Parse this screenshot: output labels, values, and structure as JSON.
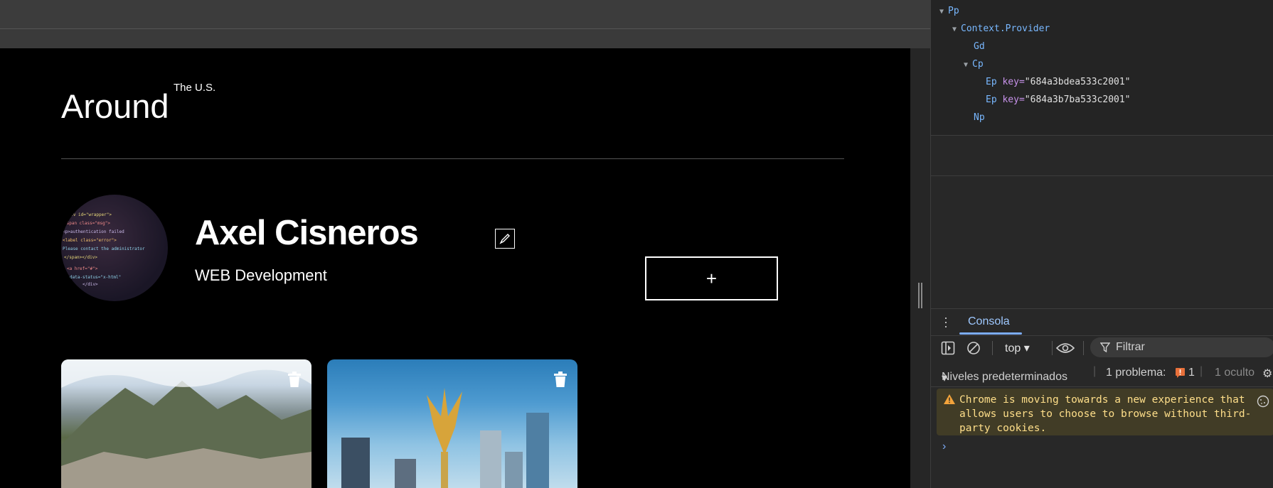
{
  "page": {
    "logo": "Around",
    "logo_sup": "The U.S.",
    "profile": {
      "name": "Axel Cisneros",
      "job": "WEB Development"
    },
    "add_button": "+",
    "cards": [
      {
        "trash_icon": "trash-icon"
      },
      {
        "trash_icon": "trash-icon"
      }
    ]
  },
  "devtools": {
    "tree": [
      {
        "label": "Pp"
      },
      {
        "label": "Context.Provider"
      },
      {
        "label": "Gd"
      },
      {
        "label": "Cp"
      },
      {
        "label": "Ep",
        "attr": "key",
        "value": "\"684a3bdea533c2001\""
      },
      {
        "label": "Ep",
        "attr": "key",
        "value": "\"684a3b7ba533c2001\""
      },
      {
        "label": "Np"
      }
    ],
    "console_tab": "Consola",
    "context": "top",
    "filter_placeholder": "Filtrar",
    "levels": "Niveles predeterminados",
    "problems_label": "1 problema:",
    "problems_count": "1",
    "hidden": "1 oculto",
    "warning": "Chrome is moving towards a new experience that allows users to choose to browse without third-party cookies.",
    "prompt": "›"
  },
  "colors": {
    "accent": "#7cacf8",
    "warning_bg": "#413c26",
    "warning_text": "#ffdf8a",
    "component": "#79b8ff"
  }
}
